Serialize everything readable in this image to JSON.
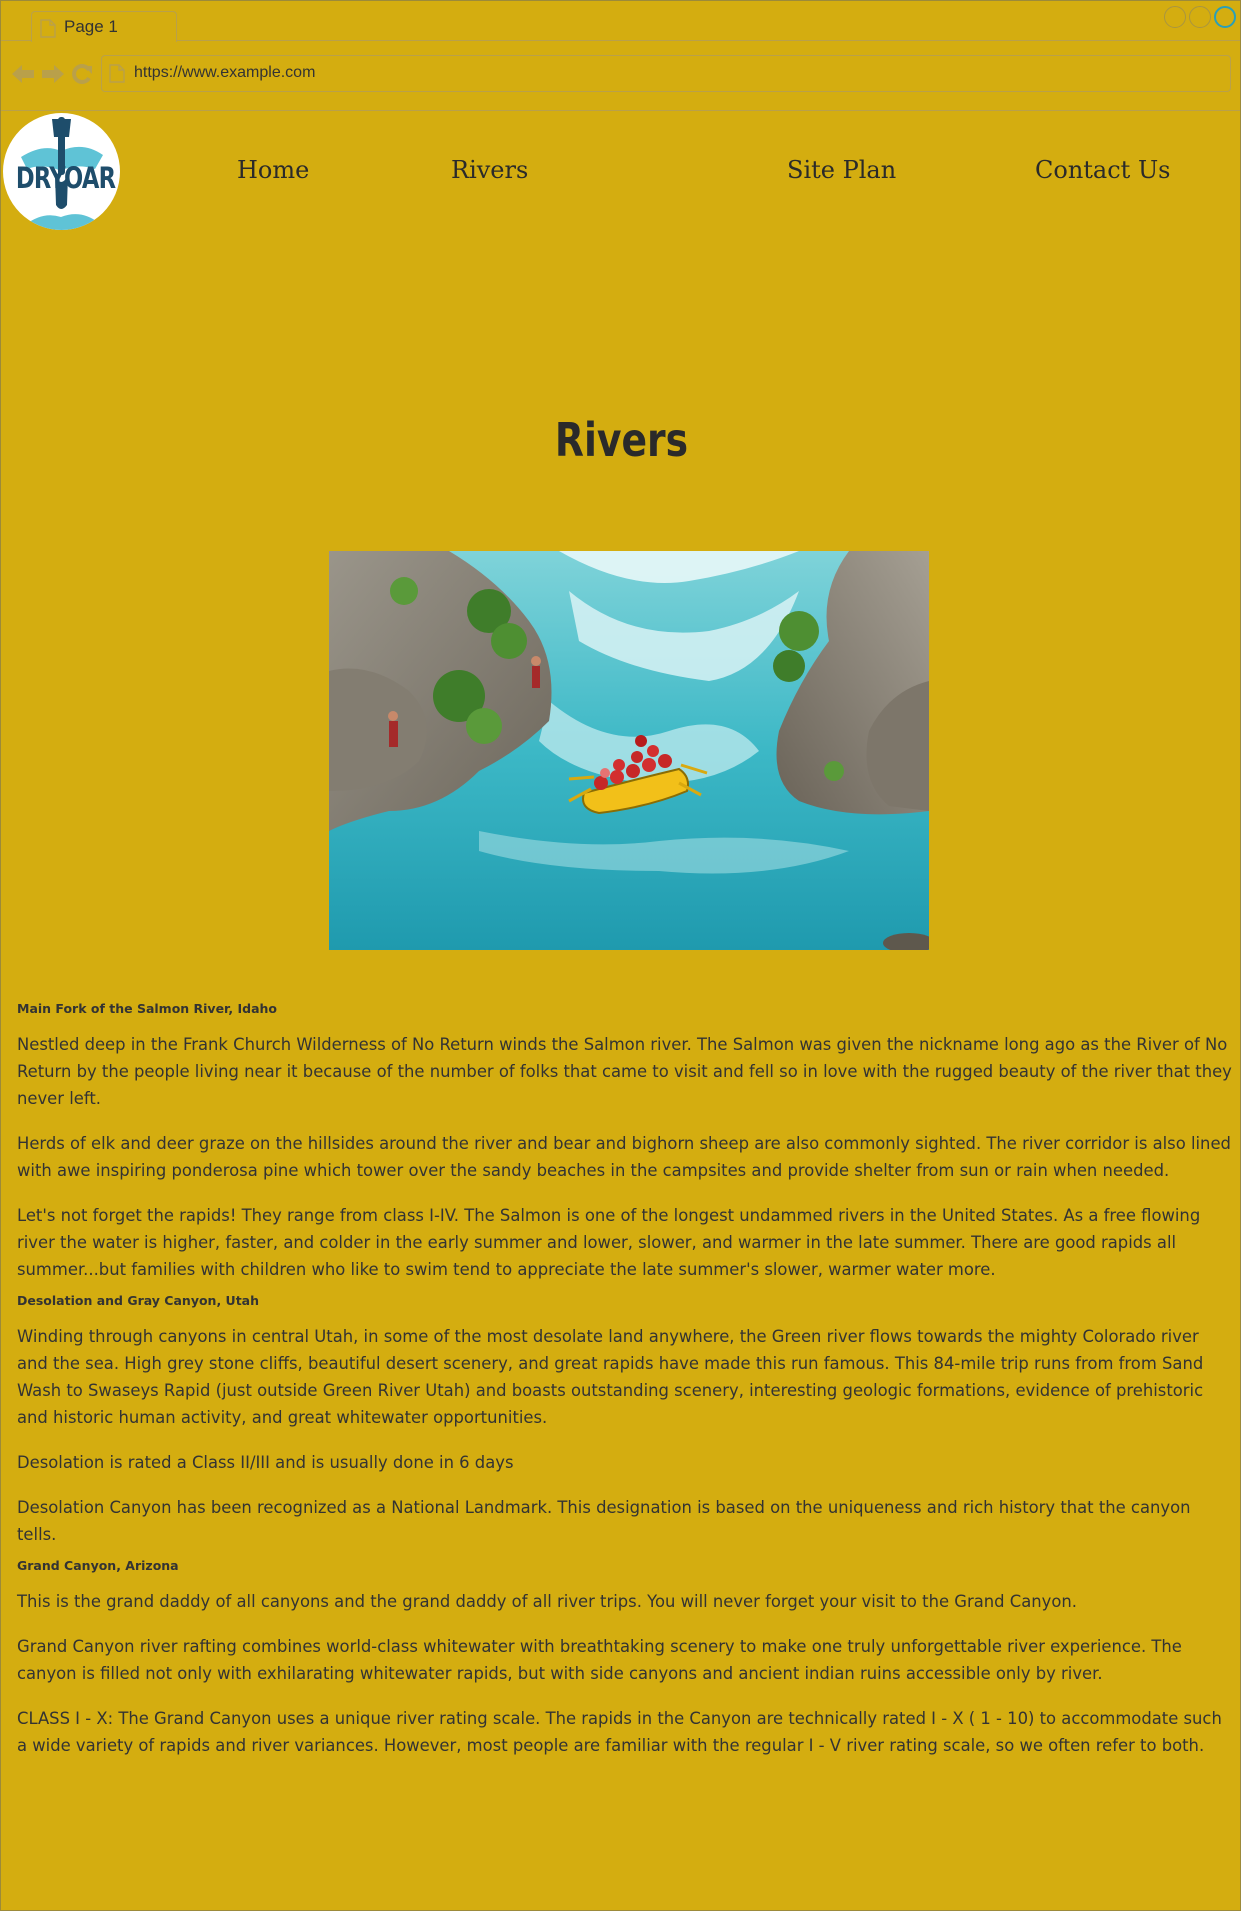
{
  "browser": {
    "tab_title": "Page 1",
    "url": "https://www.example.com"
  },
  "site": {
    "logo_text": "DRYOAR",
    "nav": [
      {
        "label": "Home"
      },
      {
        "label": "Rivers"
      },
      {
        "label": "Site Plan"
      },
      {
        "label": "Contact Us"
      }
    ]
  },
  "page": {
    "title": "Rivers",
    "hero_image": "river-rafting-photo",
    "sections": [
      {
        "heading": "Main Fork of the Salmon River, Idaho",
        "paragraphs": [
          "Nestled deep in the Frank Church Wilderness of No Return winds the Salmon river. The Salmon was given the nickname long ago as the River of No Return by the people living near it because of the number of folks that came to visit and fell so in love with the rugged beauty of the river that they never left.",
          "Herds of elk and deer graze on the hillsides around the river and bear and bighorn sheep are also commonly sighted. The river corridor is also lined with awe inspiring ponderosa pine which tower over the sandy beaches in the campsites and provide shelter from sun or rain when needed.",
          "Let's not forget the rapids! They range from class I-IV. The Salmon is one of the longest undammed rivers in the United States. As a free flowing river the water is higher, faster, and colder in the early summer and lower, slower, and warmer in the late summer. There are good rapids all summer...but families with children who like to swim tend to appreciate the late summer's slower, warmer water more."
        ]
      },
      {
        "heading": "Desolation and Gray Canyon, Utah",
        "paragraphs": [
          "Winding through canyons in central Utah, in some of the most desolate land anywhere, the Green river flows towards the mighty Colorado river and the sea. High grey stone cliffs, beautiful desert scenery, and great rapids have made this run famous. This 84-mile trip runs from from Sand Wash to Swaseys Rapid (just outside Green River Utah) and boasts outstanding scenery, interesting geologic formations, evidence of prehistoric and historic human activity, and great whitewater opportunities.",
          "Desolation is rated a Class II/III and is usually done in 6 days",
          "Desolation Canyon has been recognized as a National Landmark.  This designation is based on the uniqueness and rich history that the canyon tells."
        ]
      },
      {
        "heading": "Grand Canyon, Arizona",
        "paragraphs": [
          "This is the grand daddy of all canyons and the grand daddy of all river trips. You will never forget your visit to the Grand Canyon.",
          "Grand Canyon river rafting combines world-class whitewater with breathtaking scenery to make one truly unforgettable river experience. The canyon is filled not only with exhilarating whitewater rapids, but with side canyons and ancient indian ruins accessible only by river.",
          "CLASS I - X: The Grand Canyon uses a unique river rating scale. The rapids in the Canyon are technically rated I - X ( 1 - 10) to accommodate such a wide variety of rapids and river variances. However, most people are familiar with the regular I - V river rating scale, so we often refer to both."
        ]
      }
    ]
  },
  "colors": {
    "background": "#d4ad10",
    "text": "#333333",
    "logo_blue": "#1e4d6b",
    "water": "#2fb5c4"
  }
}
